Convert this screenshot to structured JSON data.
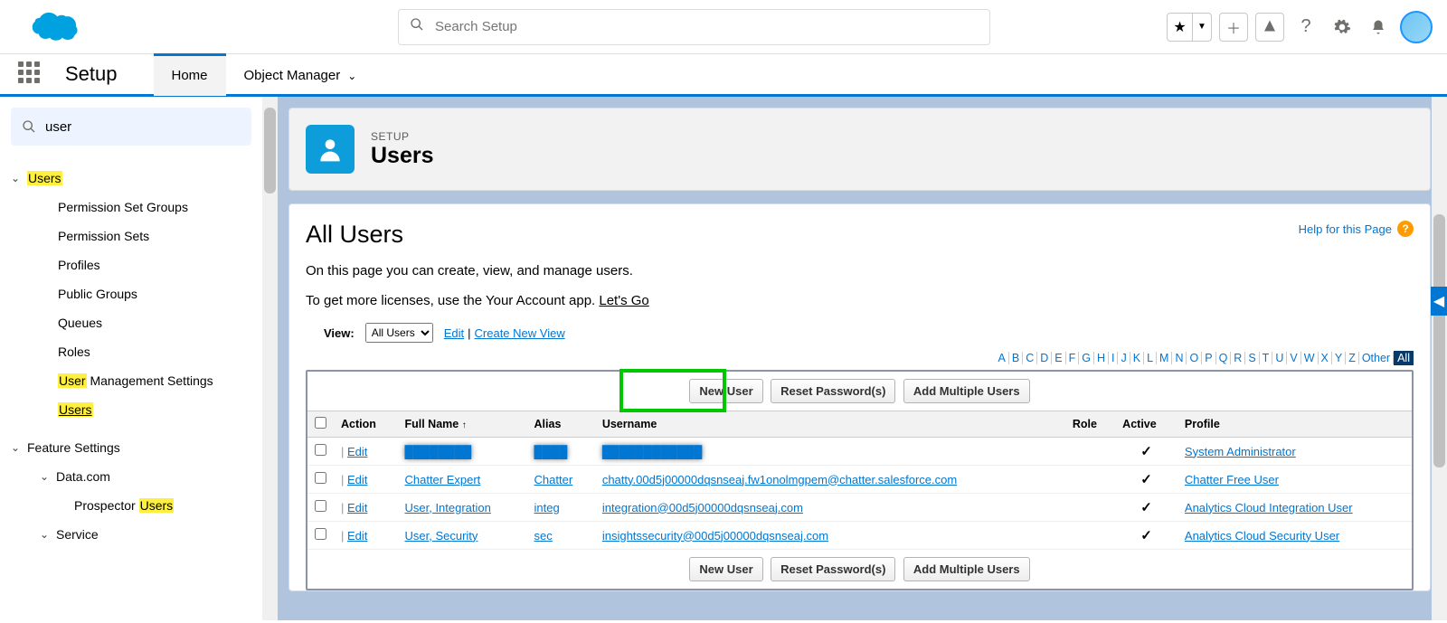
{
  "topbar": {
    "search_placeholder": "Search Setup"
  },
  "nav": {
    "setup_label": "Setup",
    "tabs": {
      "home": "Home",
      "object_manager": "Object Manager"
    }
  },
  "sidebar": {
    "search_value": "user",
    "tree": {
      "users_root": "Users",
      "perm_set_groups": "Permission Set Groups",
      "perm_sets": "Permission Sets",
      "profiles": "Profiles",
      "public_groups": "Public Groups",
      "queues": "Queues",
      "roles": "Roles",
      "user_mgmt_prefix": "User",
      "user_mgmt_suffix": " Management Settings",
      "users": "Users",
      "feature_settings": "Feature Settings",
      "data_com": "Data.com",
      "prospector_prefix": "Prospector ",
      "prospector_suffix": "Users",
      "service": "Service"
    }
  },
  "header_card": {
    "breadcrumb": "SETUP",
    "title": "Users"
  },
  "page": {
    "section_title": "All Users",
    "help_link": "Help for this Page",
    "desc1": "On this page you can create, view, and manage users.",
    "desc2_prefix": "To get more licenses, use the Your Account app. ",
    "desc2_link": "Let's Go",
    "view_label": "View:",
    "view_select": "All Users",
    "edit_link": "Edit",
    "create_new_view": "Create New View",
    "alpha_letters": [
      "A",
      "B",
      "C",
      "D",
      "E",
      "F",
      "G",
      "H",
      "I",
      "J",
      "K",
      "L",
      "M",
      "N",
      "O",
      "P",
      "Q",
      "R",
      "S",
      "T",
      "U",
      "V",
      "W",
      "X",
      "Y",
      "Z"
    ],
    "other_label": "Other",
    "all_label": "All"
  },
  "buttons": {
    "new_user": "New User",
    "reset_pw": "Reset Password(s)",
    "add_multiple": "Add Multiple Users"
  },
  "table": {
    "columns": {
      "action": "Action",
      "full_name": "Full Name",
      "alias": "Alias",
      "username": "Username",
      "role": "Role",
      "active": "Active",
      "profile": "Profile"
    },
    "edit_label": "Edit",
    "rows": [
      {
        "full_name": "████████",
        "alias": "████",
        "username": "████████████",
        "active": "✓",
        "profile": "System Administrator",
        "blur": true
      },
      {
        "full_name": "Chatter Expert",
        "alias": "Chatter",
        "username": "chatty.00d5j00000dqsnseaj.fw1onolmgpem@chatter.salesforce.com",
        "active": "✓",
        "profile": "Chatter Free User"
      },
      {
        "full_name": "User, Integration",
        "alias": "integ",
        "username": "integration@00d5j00000dqsnseaj.com",
        "active": "✓",
        "profile": "Analytics Cloud Integration User"
      },
      {
        "full_name": "User, Security",
        "alias": "sec",
        "username": "insightssecurity@00d5j00000dqsnseaj.com",
        "active": "✓",
        "profile": "Analytics Cloud Security User"
      }
    ]
  }
}
